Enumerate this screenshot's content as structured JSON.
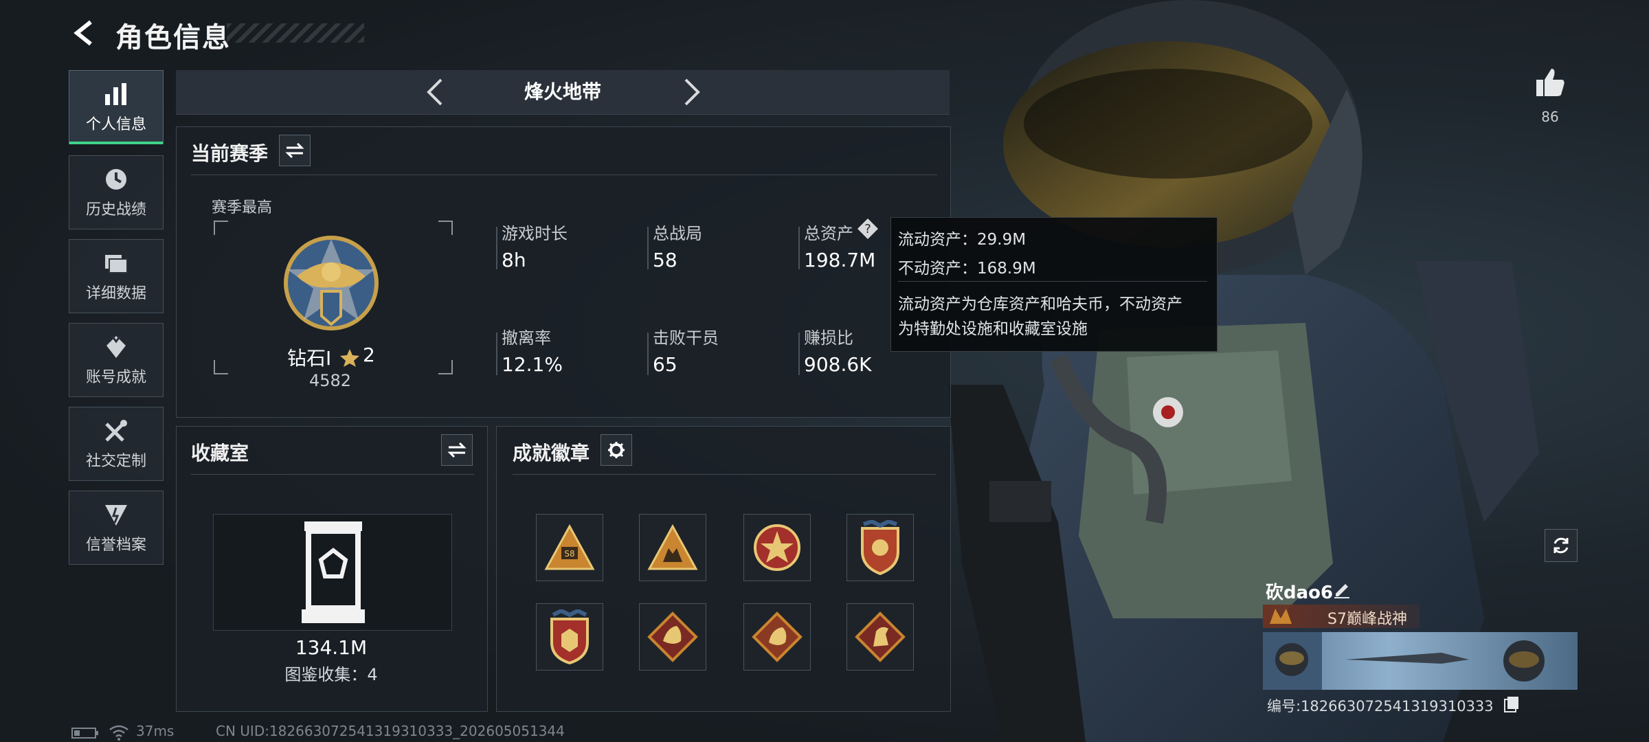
{
  "header": {
    "title": "角色信息"
  },
  "sidebar": {
    "items": [
      {
        "label": "个人信息",
        "icon": "bar-chart-icon",
        "active": true
      },
      {
        "label": "历史战绩",
        "icon": "history-clock-icon",
        "active": false
      },
      {
        "label": "详细数据",
        "icon": "folder-icon",
        "active": false
      },
      {
        "label": "账号成就",
        "icon": "achievement-icon",
        "active": false
      },
      {
        "label": "社交定制",
        "icon": "tools-icon",
        "active": false
      },
      {
        "label": "信誉档案",
        "icon": "reputation-icon",
        "active": false
      }
    ]
  },
  "mode_tabs": {
    "current": "烽火地带"
  },
  "season": {
    "title": "当前赛季",
    "best_label": "赛季最高",
    "rank_name": "钻石I",
    "rank_stars": "2",
    "rank_score": "4582",
    "stats": [
      {
        "label": "游戏时长",
        "value": "8h"
      },
      {
        "label": "总战局",
        "value": "58"
      },
      {
        "label": "总资产",
        "value": "198.7M"
      },
      {
        "label": "撤离率",
        "value": "12.1%"
      },
      {
        "label": "击败干员",
        "value": "65"
      },
      {
        "label": "赚损比",
        "value": "908.6K"
      }
    ]
  },
  "asset_tooltip": {
    "liquid": "流动资产：29.9M",
    "fixed": "不动资产：168.9M",
    "desc_line1": "流动资产为仓库资产和哈夫币，不动资产",
    "desc_line2": "为特勤处设施和收藏室设施"
  },
  "collection": {
    "title": "收藏室",
    "value": "134.1M",
    "catalog": "图鉴收集：4"
  },
  "badges": {
    "title": "成就徽章",
    "items": [
      "badge-triangle-s8",
      "badge-triangle-team",
      "badge-star-round",
      "badge-shield-crown",
      "badge-shield-stars",
      "badge-dragon-diamond-1",
      "badge-dragon-diamond-2",
      "badge-horse-diamond"
    ]
  },
  "likes": {
    "count": "86"
  },
  "player": {
    "name": "砍dao6",
    "title": "S7巅峰战神",
    "id_text": "编号:182663072541319310333"
  },
  "status_bar": {
    "ping": "37ms",
    "uid": "CN UID:182663072541319310333_202605051344"
  },
  "colors": {
    "accent": "#3fd28b",
    "gold": "#d9b25a"
  }
}
